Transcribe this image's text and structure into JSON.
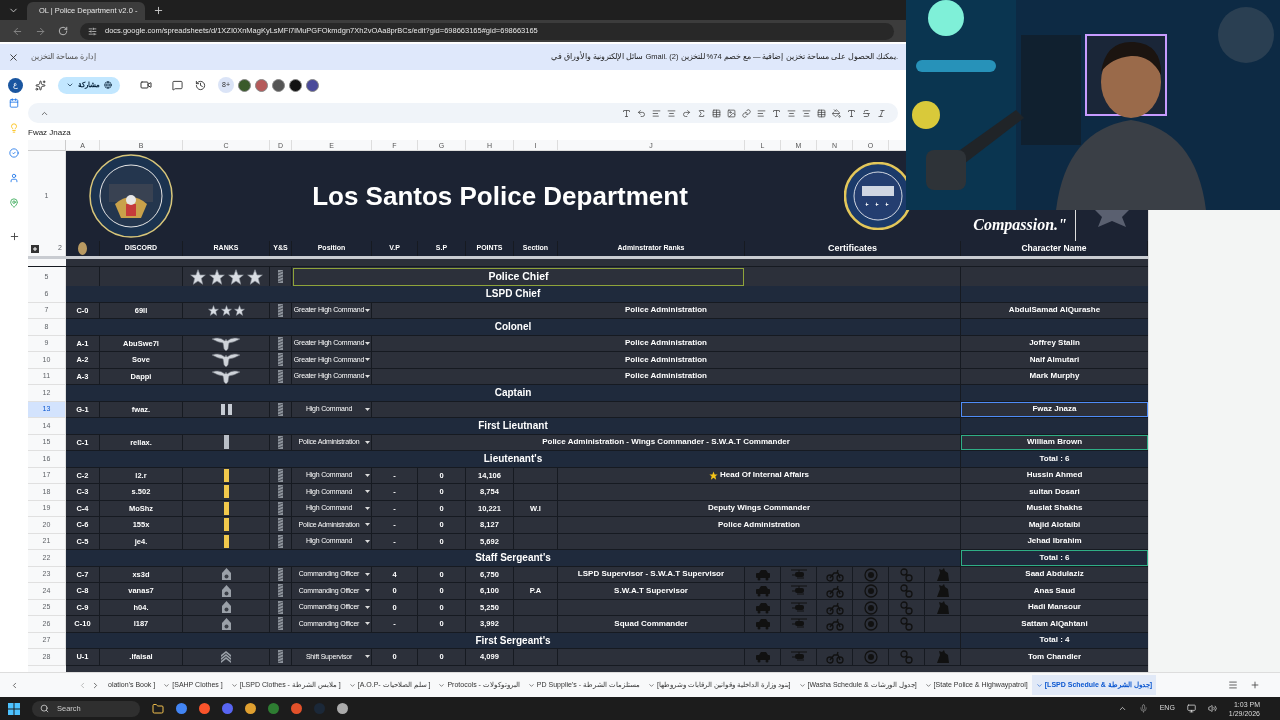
{
  "browser": {
    "tab_title": "OL | Police Department v2.0 -",
    "url": "docs.google.com/spreadsheets/d/1XZI0XnMagKyLsMFi7iMuPGFOkmdgn7Xh2vOAa8prBCs/edit?gid=698663165#gid=698663165"
  },
  "banner": {
    "link": "إدارة مساحة التخزين",
    "message": "سائل الإلكترونية والأوراق في Gmail. يمكنك الحصول على مساحة تخزين إضافية — مع خصم 74% للتخزين (2)."
  },
  "toolbar": {
    "account": "ع",
    "share": "مشاركة",
    "more_collaborators": "8+"
  },
  "name_box": "Fwaz Jnaza",
  "columns": [
    "A",
    "B",
    "C",
    "D",
    "E",
    "F",
    "G",
    "H",
    "I",
    "J",
    "L",
    "M",
    "N",
    "O"
  ],
  "sheet": {
    "title_row_number": "1",
    "header_row_number": "2",
    "title": "Los Santos Police Department",
    "quote": "Compassion.\"",
    "headers": [
      "DISCORD",
      "RANKS",
      "Y&S",
      "Position",
      "V.P",
      "S.P",
      "POINTS",
      "Section",
      "Adminstrator Ranks",
      "Certificates",
      "Character Name"
    ],
    "rows": [
      {
        "kind": "rank_title",
        "number": "5",
        "title": "Police Chief",
        "stars": 4,
        "selected": false,
        "outlined": false
      },
      {
        "kind": "section",
        "number": "6",
        "title": "LSPD Chief",
        "selected": false,
        "outlined": false
      },
      {
        "kind": "member",
        "number": "7",
        "id": "C-0",
        "discord": "69ll",
        "insignia": {
          "kind": "stars",
          "stars": 3
        },
        "position": "Greater High Command",
        "admin": "Police Administration",
        "name": "AbdulSamad AlQurashe",
        "selected": false,
        "outlined": false
      },
      {
        "kind": "section",
        "number": "8",
        "title": "Colonel",
        "selected": false,
        "outlined": false
      },
      {
        "kind": "member",
        "number": "9",
        "id": "A-1",
        "discord": "AbuSwe7l",
        "insignia": {
          "kind": "eagle"
        },
        "position": "Greater High Command",
        "admin": "Police Administration",
        "name": "Joffrey Stalin",
        "selected": false,
        "outlined": false
      },
      {
        "kind": "member",
        "number": "10",
        "id": "A-2",
        "discord": "Sove",
        "insignia": {
          "kind": "eagle"
        },
        "position": "Greater High Command",
        "admin": "Police Administration",
        "name": "Naif Almutari",
        "selected": false,
        "outlined": false
      },
      {
        "kind": "member",
        "number": "11",
        "id": "A-3",
        "discord": "Dappi",
        "insignia": {
          "kind": "eagle"
        },
        "position": "Greater High Command",
        "admin": "Police Administration",
        "name": "Mark Murphy",
        "selected": false,
        "outlined": false
      },
      {
        "kind": "section",
        "number": "12",
        "title": "Captain",
        "selected": false,
        "outlined": false
      },
      {
        "kind": "member",
        "number": "13",
        "id": "G-1",
        "discord": "fwaz.",
        "insignia": {
          "kind": "bars"
        },
        "position": "High Command",
        "name": "Fwaz Jnaza",
        "selected": true,
        "outlined": false
      },
      {
        "kind": "section",
        "number": "14",
        "title": "First Lieutnant",
        "selected": false,
        "outlined": false
      },
      {
        "kind": "member",
        "number": "15",
        "id": "C-1",
        "discord": "rellax.",
        "insignia": {
          "kind": "bar_silver"
        },
        "position": "Police Administration",
        "admin": "Police Administration -  Wings Commander - S.W.A.T Commander",
        "name": "William Brown",
        "selected": false,
        "outlined": true
      },
      {
        "kind": "section",
        "number": "16",
        "title": "Lieutenant's",
        "total": "Total : 6",
        "selected": false,
        "outlined": false
      },
      {
        "kind": "member",
        "number": "17",
        "id": "C-2",
        "discord": "l2.r",
        "insignia": {
          "kind": "bar_gold"
        },
        "position": "High Command",
        "vp": "-",
        "sp": "0",
        "points": "14,106",
        "admin": "Head Of Internal Affairs",
        "starred": true,
        "name": "Hussin Ahmed",
        "selected": false,
        "outlined": false
      },
      {
        "kind": "member",
        "number": "18",
        "id": "C-3",
        "discord": "s.502",
        "insignia": {
          "kind": "bar_gold"
        },
        "position": "High Command",
        "vp": "-",
        "sp": "0",
        "points": "8,754",
        "name": "sultan Dosari",
        "selected": false,
        "outlined": false
      },
      {
        "kind": "member",
        "number": "19",
        "id": "C-4",
        "discord": "MoShz",
        "insignia": {
          "kind": "bar_gold"
        },
        "position": "High Command",
        "vp": "-",
        "sp": "0",
        "points": "10,221",
        "section": "W.I",
        "admin": "Deputy Wings Commander",
        "name": "Muslat Shakhs",
        "selected": false,
        "outlined": false
      },
      {
        "kind": "member",
        "number": "20",
        "id": "C-6",
        "discord": "155x",
        "insignia": {
          "kind": "bar_gold"
        },
        "position": "Police Administration",
        "vp": "-",
        "sp": "0",
        "points": "8,127",
        "admin": "Police Administration",
        "name": "Majid Alotaibi",
        "selected": false,
        "outlined": false
      },
      {
        "kind": "member",
        "number": "21",
        "id": "C-5",
        "discord": "je4.",
        "insignia": {
          "kind": "bar_gold"
        },
        "position": "High Command",
        "vp": "-",
        "sp": "0",
        "points": "5,692",
        "name": "Jehad Ibrahim",
        "selected": false,
        "outlined": false
      },
      {
        "kind": "section",
        "number": "22",
        "title": "Staff Sergeant's",
        "total": "Total : 6",
        "selected": false,
        "outlined": true
      },
      {
        "kind": "member",
        "number": "23",
        "id": "C-7",
        "discord": "xs3d",
        "insignia": {
          "kind": "chevron"
        },
        "position": "Commanding Officer",
        "vp": "4",
        "sp": "0",
        "points": "6,750",
        "admin": "LSPD Supervisor - S.W.A.T Supervisor",
        "certs": [
          true,
          true,
          true,
          true,
          true,
          true
        ],
        "name": "Saad Abdulaziz",
        "selected": false,
        "outlined": false
      },
      {
        "kind": "member",
        "number": "24",
        "id": "C-8",
        "discord": "vanas7",
        "insignia": {
          "kind": "chevron"
        },
        "position": "Commanding Officer",
        "vp": "0",
        "sp": "0",
        "points": "6,100",
        "section": "P.A",
        "admin": "S.W.A.T Supervisor",
        "certs": [
          true,
          true,
          true,
          true,
          true,
          true
        ],
        "name": "Anas Saud",
        "selected": false,
        "outlined": false
      },
      {
        "kind": "member",
        "number": "25",
        "id": "C-9",
        "discord": "h04.",
        "insignia": {
          "kind": "chevron"
        },
        "position": "Commanding Officer",
        "vp": "0",
        "sp": "0",
        "points": "5,250",
        "certs": [
          true,
          true,
          true,
          true,
          true,
          true
        ],
        "name": "Hadi Mansour",
        "selected": false,
        "outlined": false
      },
      {
        "kind": "member",
        "number": "26",
        "id": "C-10",
        "discord": "l187",
        "insignia": {
          "kind": "chevron"
        },
        "position": "Commanding Officer",
        "vp": "-",
        "sp": "0",
        "points": "3,992",
        "admin": "Squad Commander",
        "certs": [
          true,
          true,
          true,
          true,
          true,
          false
        ],
        "name": "Sattam AlQahtani",
        "selected": false,
        "outlined": false
      },
      {
        "kind": "section",
        "number": "27",
        "title": "First Sergeant's",
        "total": "Total : 4",
        "selected": false,
        "outlined": false
      },
      {
        "kind": "member",
        "number": "28",
        "id": "U-1",
        "discord": ".lfaisal",
        "insignia": {
          "kind": "chevrons"
        },
        "position": "Shift Supervisor",
        "vp": "0",
        "sp": "0",
        "points": "4,099",
        "certs": [
          true,
          true,
          true,
          true,
          true,
          true
        ],
        "name": "Tom Chandler",
        "selected": false,
        "outlined": false
      }
    ]
  },
  "sheet_tabs": [
    {
      "label": "olation's Book ]",
      "selected": false
    },
    {
      "label": "[SAHP Clothes ]",
      "selected": false
    },
    {
      "label": "[LSPD Clothes - ملابس الشرطة ]",
      "selected": false
    },
    {
      "label": "[A.O.P- سلم الصلاحيات ]",
      "selected": false
    },
    {
      "label": "Protocols - البروتوكولات",
      "selected": false
    },
    {
      "label": "PD Supplie's - مستلزمات الشرطة",
      "selected": false
    },
    {
      "label": "[بنود وزارة الداخلية وقوانين الرقابات وشروطها]",
      "selected": false
    },
    {
      "label": "[Washa Schedule & جدول الورشات]",
      "selected": false
    },
    {
      "label": "[State Police & Highwaypatrol]",
      "selected": false
    },
    {
      "label": "[LSPD Schedule & جدول الشرطة]",
      "selected": true
    }
  ],
  "taskbar": {
    "search": "Search",
    "language": "ENG",
    "time": "1:03 PM",
    "date": "1/29/2026"
  }
}
